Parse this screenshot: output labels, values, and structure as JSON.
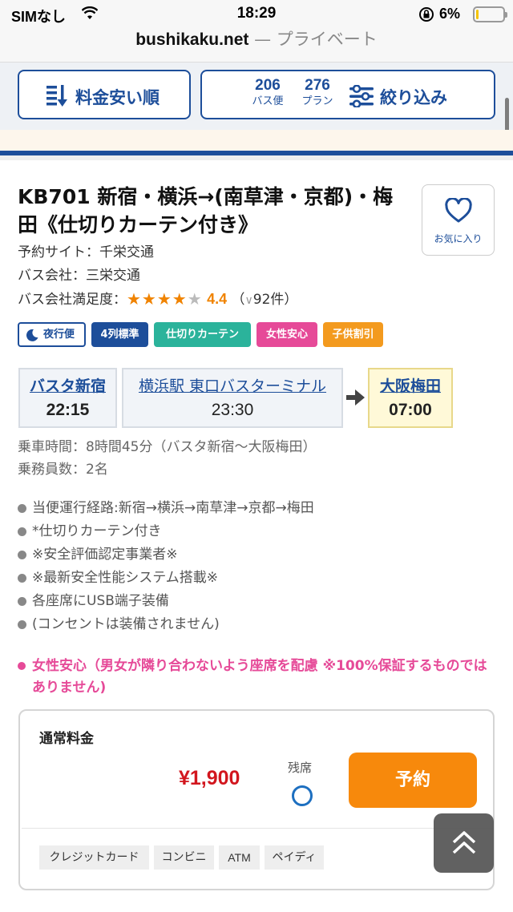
{
  "status_bar": {
    "carrier": "SIMなし",
    "time": "18:29",
    "battery_pct": "6%",
    "battery_level": 0.06
  },
  "url_bar": {
    "domain": "bushikaku.net",
    "mode": " — プライベート"
  },
  "toolbar": {
    "sort_label": "料金安い順",
    "bus_count": "206",
    "bus_unit": "バス便",
    "plan_count": "276",
    "plan_unit": "プラン",
    "filter_label": "絞り込み"
  },
  "bus": {
    "title": "KB701 新宿・横浜→(南草津・京都)・梅田《仕切りカーテン付き》",
    "favorite_label": "お気に入り",
    "site_line": "予約サイト：千栄交通",
    "company_line": "バス会社：三栄交通",
    "rating_label": "バス会社満足度：",
    "rating_stars": "★★★★",
    "rating_half_star": "★",
    "rating_value": "4.4",
    "rating_value_num": 4.4,
    "review_open": "（",
    "review_count": "92件）",
    "tags": {
      "night": "夜行便",
      "seat": "4列標準",
      "curtain": "仕切りカーテン",
      "female": "女性安心",
      "child": "子供割引"
    },
    "stops": [
      {
        "name": "バスタ新宿",
        "time": "22:15"
      },
      {
        "name": "横浜駅 東口バスターミナル",
        "time": "23:30"
      },
      {
        "name": "大阪梅田",
        "time": "07:00"
      }
    ],
    "duration_line": "乗車時間：8時間45分（バスタ新宿〜大阪梅田）",
    "crew_line": "乗務員数：2名",
    "notes": [
      "当便運行経路:新宿→横浜→南草津→京都→梅田",
      "*仕切りカーテン付き",
      "※安全評価認定事業者※",
      "※最新安全性能システム搭載※",
      "各座席にUSB端子装備",
      "(コンセントは装備されません)"
    ],
    "female_note": "女性安心（男女が隣り合わないよう座席を配慮 ※100%保証するものではありません)"
  },
  "fare": {
    "title": "通常料金",
    "price": "¥1,900",
    "seat_label": "残席",
    "reserve_label": "予約",
    "payments": [
      "クレジットカード",
      "コンビニ",
      "ATM",
      "ペイディ"
    ]
  },
  "colors": {
    "brand_blue": "#1d4e9a",
    "price_red": "#d2161e",
    "reserve_orange": "#f7890c",
    "star_orange": "#f08300",
    "female_pink": "#e64a98"
  }
}
